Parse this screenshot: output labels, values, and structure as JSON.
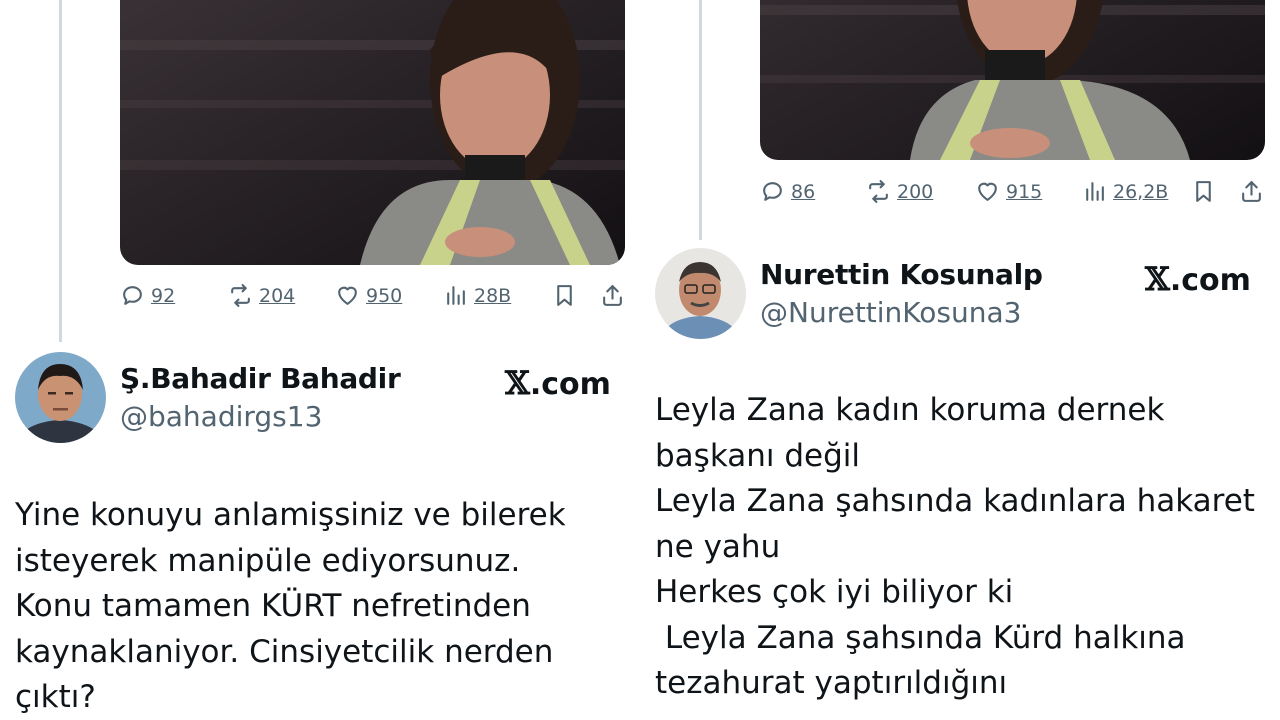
{
  "left_tweet": {
    "stats": {
      "replies": "92",
      "reposts": "204",
      "likes": "950",
      "views": "28B"
    },
    "reply": {
      "display_name": "Ş.Bahadir Bahadir",
      "handle": "@bahadirgs13",
      "brand": ".com",
      "text_lines": [
        "Yine konuyu anlamişsiniz ve bilerek",
        "isteyerek manipüle ediyorsunuz.",
        "Konu tamamen KÜRT nefretinden",
        "kaynaklaniyor. Cinsiyetcilik nerden",
        "çıktı?"
      ]
    }
  },
  "right_tweet": {
    "stats": {
      "replies": "86",
      "reposts": "200",
      "likes": "915",
      "views": "26,2B"
    },
    "reply": {
      "display_name": "Nurettin Kosunalp",
      "handle": "@NurettinKosuna3",
      "brand": ".com",
      "text_lines": [
        "Leyla Zana kadın koruma dernek",
        "başkanı değil",
        "Leyla Zana şahsında kadınlara hakaret",
        "ne yahu",
        "Herkes çok iyi biliyor ki",
        " Leyla Zana şahsında Kürd halkına",
        "tezahurat yaptırıldığını"
      ]
    }
  },
  "icons": [
    "reply-icon",
    "repost-icon",
    "like-icon",
    "views-icon",
    "bookmark-icon",
    "share-icon",
    "x-logo-icon"
  ],
  "colors": {
    "text": "#0f1419",
    "secondary": "#536471",
    "thread_line": "#cfd9de",
    "background": "#ffffff"
  }
}
